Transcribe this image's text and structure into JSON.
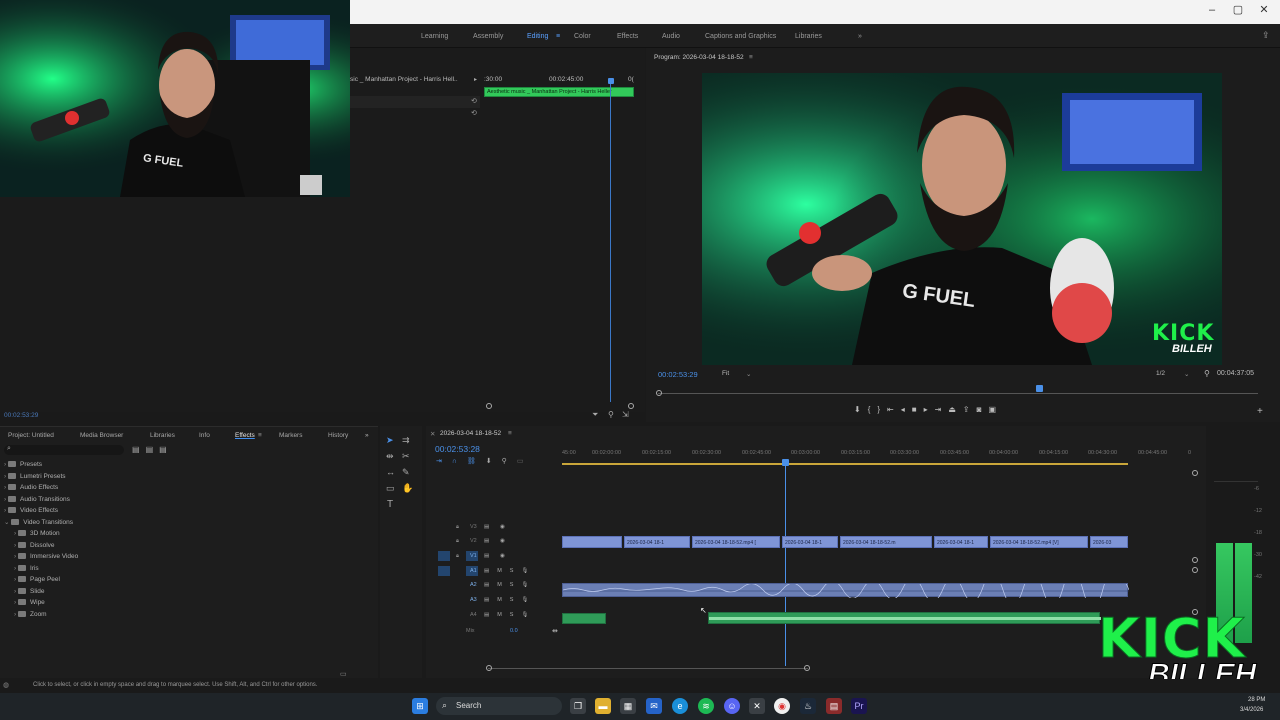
{
  "window": {
    "minimize": "–",
    "maximize": "▢",
    "close": "✕"
  },
  "workspaces": [
    "Learning",
    "Assembly",
    "Editing",
    "Color",
    "Effects",
    "Audio",
    "Captions and Graphics",
    "Libraries"
  ],
  "active_workspace": "Editing",
  "source_monitor": {
    "clip_name": "Aesthetic music _ Manhattan Project - Harris Heller",
    "header_clip": "sic _ Manhattan Project - Harris Hell..",
    "ruler": [
      ":30:00",
      "00:02:45:00",
      "0("
    ],
    "timecode": "00:02:53:29"
  },
  "program_monitor": {
    "title": "Program: 2026-03-04 18-18-52",
    "timecode": "00:02:53:29",
    "fit": "Fit",
    "resolution": "1/2",
    "duration": "00:04:37:05"
  },
  "project_panel": {
    "tabs": [
      "Project: Untitled",
      "Media Browser",
      "Libraries",
      "Info",
      "Effects",
      "Markers",
      "History"
    ],
    "active_tab": "Effects",
    "tree": [
      {
        "label": "Presets",
        "level": 0
      },
      {
        "label": "Lumetri Presets",
        "level": 0
      },
      {
        "label": "Audio Effects",
        "level": 0
      },
      {
        "label": "Audio Transitions",
        "level": 0
      },
      {
        "label": "Video Effects",
        "level": 0
      },
      {
        "label": "Video Transitions",
        "level": 0
      },
      {
        "label": "3D Motion",
        "level": 1
      },
      {
        "label": "Dissolve",
        "level": 1
      },
      {
        "label": "Immersive Video",
        "level": 1
      },
      {
        "label": "Iris",
        "level": 1
      },
      {
        "label": "Page Peel",
        "level": 1
      },
      {
        "label": "Slide",
        "level": 1
      },
      {
        "label": "Wipe",
        "level": 1
      },
      {
        "label": "Zoom",
        "level": 1
      }
    ]
  },
  "timeline": {
    "sequence": "2026-03-04 18-18-52",
    "timecode": "00:02:53:28",
    "ruler": [
      "45:00",
      "00:02:00:00",
      "00:02:15:00",
      "00:02:30:00",
      "00:02:45:00",
      "00:03:00:00",
      "00:03:15:00",
      "00:03:30:00",
      "00:03:45:00",
      "00:04:00:00",
      "00:04:15:00",
      "00:04:30:00",
      "00:04:45:00",
      "0"
    ],
    "tracks": [
      "V3",
      "V2",
      "V1",
      "A1",
      "A2",
      "A3",
      "A4"
    ],
    "mix_label": "Mix",
    "mix_value": "0.0",
    "video_clips": [
      "2026-03-04 18-1",
      "2026-03-04 18-18-52.mp4 [",
      "2026-03-04 18-1",
      "2026-03-04 18-18-52.m",
      "2026-03-04 18-1",
      "2026-03-04 18-18-52.mp4 [V]",
      "2026-03"
    ]
  },
  "status_text": "Click to select, or click in empty space and drag to marquee select. Use Shift, Alt, and Ctrl for other options.",
  "taskbar": {
    "search_placeholder": "Search",
    "date": "3/4/2026",
    "time": "28 PM"
  },
  "overlay": {
    "brand_top": "KICK",
    "brand_bottom": "BILLEH",
    "monitor_brand_top": "KICK",
    "monitor_brand_bottom": "BILLEH",
    "shirt_text": "G FUEL"
  },
  "meter_scale": [
    "-6",
    "-12",
    "-18",
    "-24",
    "-30",
    "-36",
    "-42",
    "-48",
    "-54"
  ],
  "colors": {
    "accent": "#3f8ef0",
    "clip_video": "#7f95d6",
    "clip_audio_green": "#2f9b58",
    "kick_green": "#1ff04a"
  }
}
